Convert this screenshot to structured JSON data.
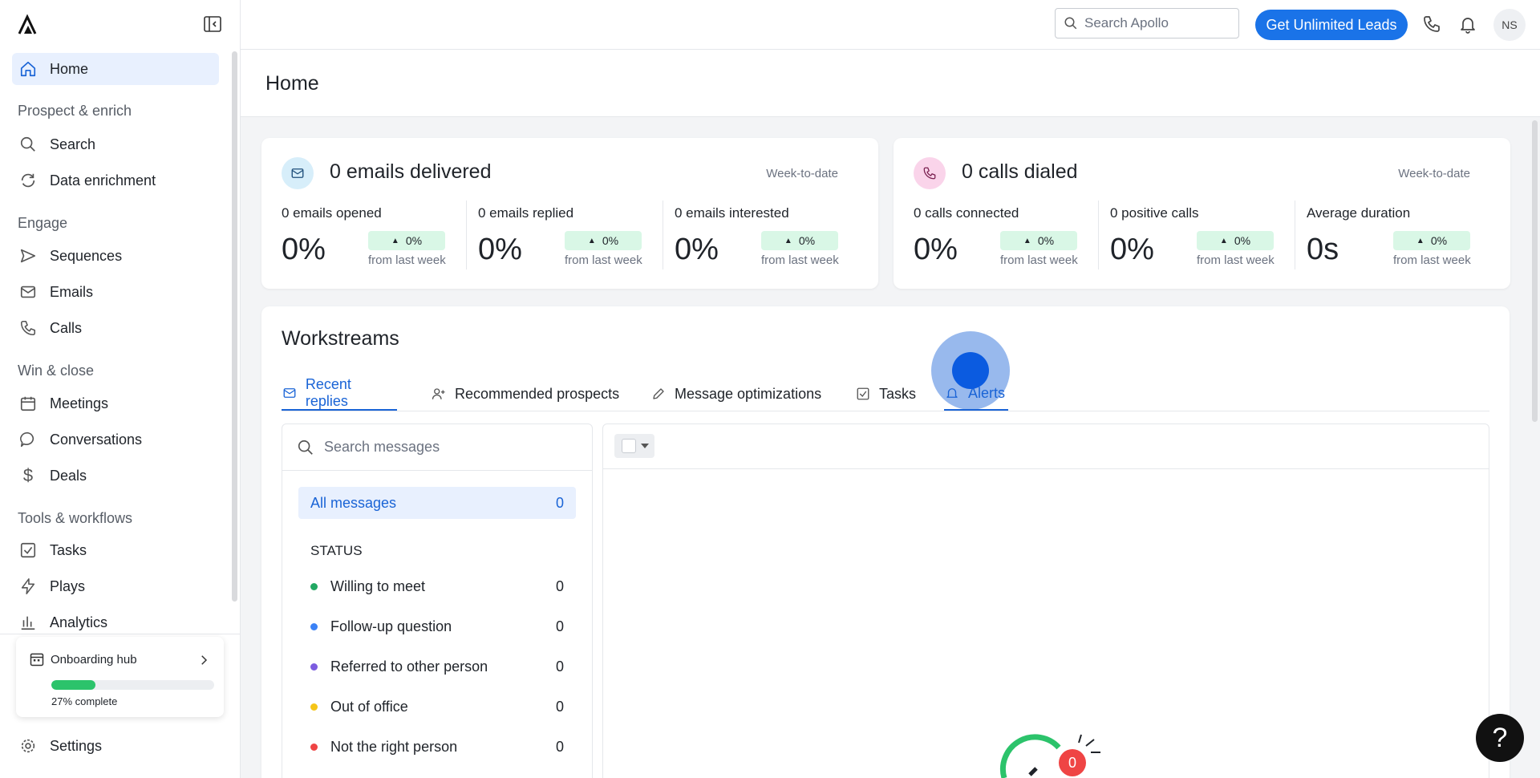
{
  "topbar": {
    "search_placeholder": "Search Apollo",
    "cta_label": "Get Unlimited Leads",
    "avatar_initials": "NS"
  },
  "sidebar": {
    "home": "Home",
    "sections": {
      "prospect": "Prospect & enrich",
      "engage": "Engage",
      "win": "Win & close",
      "tools": "Tools & workflows"
    },
    "items": {
      "search": "Search",
      "enrichment": "Data enrichment",
      "sequences": "Sequences",
      "emails": "Emails",
      "calls": "Calls",
      "meetings": "Meetings",
      "conversations": "Conversations",
      "deals": "Deals",
      "tasks": "Tasks",
      "plays": "Plays",
      "analytics": "Analytics",
      "settings": "Settings"
    },
    "onboarding": {
      "title": "Onboarding hub",
      "progress": 0.27,
      "progress_label": "27% complete"
    }
  },
  "header": {
    "title": "Home"
  },
  "emails_card": {
    "title": "0 emails delivered",
    "period": "Week-to-date",
    "metrics": [
      {
        "label": "0 emails opened",
        "value": "0%",
        "change": "0%",
        "sub": "from last week"
      },
      {
        "label": "0 emails replied",
        "value": "0%",
        "change": "0%",
        "sub": "from last week"
      },
      {
        "label": "0 emails interested",
        "value": "0%",
        "change": "0%",
        "sub": "from last week"
      }
    ]
  },
  "calls_card": {
    "title": "0 calls dialed",
    "period": "Week-to-date",
    "metrics": [
      {
        "label": "0 calls connected",
        "value": "0%",
        "change": "0%",
        "sub": "from last week"
      },
      {
        "label": "0 positive calls",
        "value": "0%",
        "change": "0%",
        "sub": "from last week"
      },
      {
        "label": "Average duration",
        "value": "0s",
        "change": "0%",
        "sub": "from last week"
      }
    ]
  },
  "workstreams": {
    "title": "Workstreams",
    "tabs": [
      {
        "label": "Recent replies"
      },
      {
        "label": "Recommended prospects"
      },
      {
        "label": "Message optimizations"
      },
      {
        "label": "Tasks"
      },
      {
        "label": "Alerts"
      }
    ],
    "search_placeholder": "Search messages",
    "all_messages": {
      "label": "All messages",
      "count": "0"
    },
    "status_heading": "STATUS",
    "statuses": [
      {
        "label": "Willing to meet",
        "count": "0",
        "color": "#22a863"
      },
      {
        "label": "Follow-up question",
        "count": "0",
        "color": "#3b82f6"
      },
      {
        "label": "Referred to other person",
        "count": "0",
        "color": "#7c5ce0"
      },
      {
        "label": "Out of office",
        "count": "0",
        "color": "#f5c518"
      },
      {
        "label": "Not the right person",
        "count": "0",
        "color": "#ef4444"
      }
    ],
    "empty_badge": "0"
  },
  "help_label": "?",
  "colors": {
    "accent": "#1a73e8",
    "active_tab": "#1a64d6",
    "success": "#2cc36b"
  }
}
